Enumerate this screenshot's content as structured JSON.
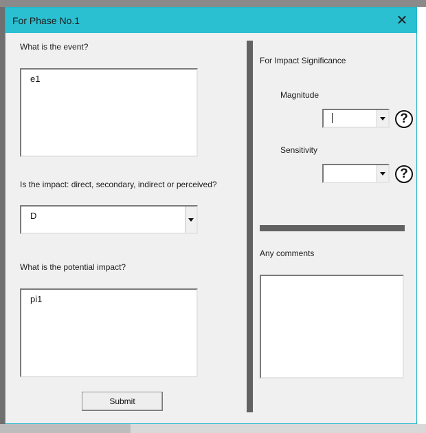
{
  "window": {
    "title": "For Phase No.1",
    "close_icon": "close-icon"
  },
  "left": {
    "event_label": "What is the event?",
    "event_value": "e1",
    "impact_type_label": "Is the impact: direct, secondary, indirect or perceived?",
    "impact_type_value": "D",
    "potential_label": "What is the potential impact?",
    "potential_value": "pi1",
    "submit_label": "Submit"
  },
  "right": {
    "significance_label": "For Impact Significance",
    "magnitude_label": "Magnitude",
    "magnitude_value": "",
    "sensitivity_label": "Sensitivity",
    "sensitivity_value": "",
    "help_glyph": "?",
    "comments_label": "Any comments",
    "comments_value": ""
  },
  "colors": {
    "titlebar": "#2bbfd2",
    "divider": "#626262"
  }
}
